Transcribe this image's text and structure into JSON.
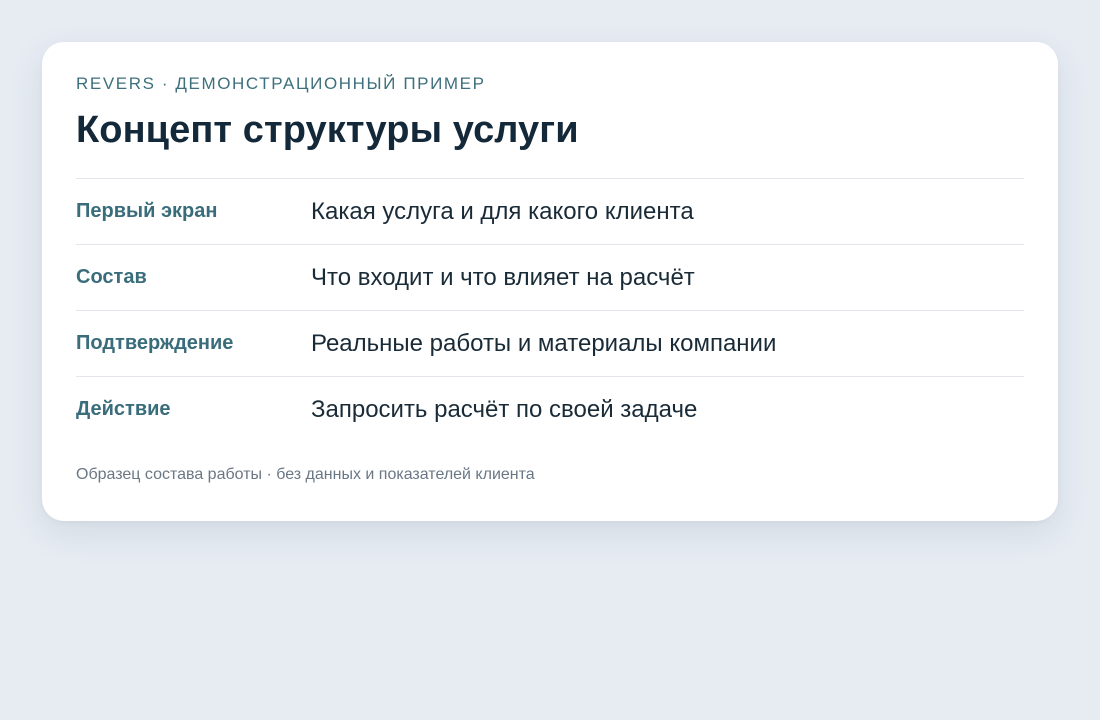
{
  "card": {
    "eyebrow": "REVERS · ДЕМОНСТРАЦИОННЫЙ ПРИМЕР",
    "title": "Концепт структуры услуги",
    "rows": [
      {
        "label": "Первый экран",
        "value": "Какая услуга и для какого клиента"
      },
      {
        "label": "Состав",
        "value": "Что входит и что влияет на расчёт"
      },
      {
        "label": "Подтверждение",
        "value": "Реальные работы и материалы компании"
      },
      {
        "label": "Действие",
        "value": "Запросить расчёт по своей задаче"
      }
    ],
    "footnote": "Образец состава работы · без данных и показателей клиента"
  },
  "colors": {
    "background": "#e7ecf3",
    "card": "#ffffff",
    "accent": "#3a6d7b",
    "heading": "#132838"
  }
}
